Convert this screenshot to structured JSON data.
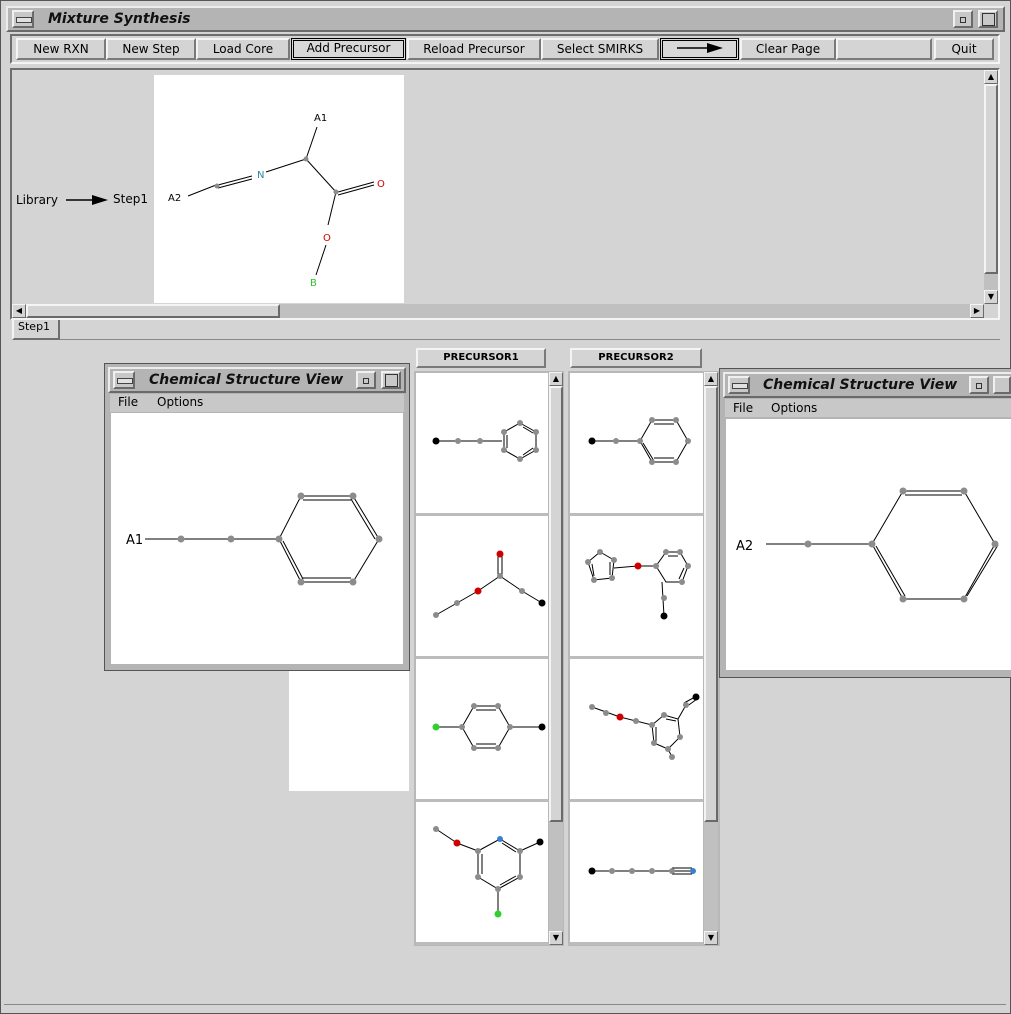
{
  "main_window": {
    "title": "Mixture Synthesis"
  },
  "toolbar": {
    "new_rxn": "New RXN",
    "new_step": "New Step",
    "load_core": "Load Core",
    "add_precursor": "Add Precursor",
    "reload_precursor": "Reload Precursor",
    "select_smirks": "Select SMIRKS",
    "arrow_icon": "right-arrow-icon",
    "clear_page": "Clear Page",
    "quit": "Quit"
  },
  "reaction": {
    "library_label": "Library",
    "step_label": "Step1",
    "core_atoms": {
      "a1": "A1",
      "a2": "A2",
      "n": "N",
      "o_double": "O",
      "o_single": "O",
      "b": "B"
    }
  },
  "tabs": {
    "step1": "Step1"
  },
  "precursor_columns": {
    "col1_header": "PRECURSOR1",
    "col2_header": "PRECURSOR2"
  },
  "structure_view_left": {
    "title": "Chemical Structure View",
    "menu_file": "File",
    "menu_options": "Options",
    "attach_label": "A1"
  },
  "structure_view_right": {
    "title": "Chemical Structure View",
    "menu_file": "File",
    "menu_options": "Options",
    "attach_label": "A2"
  },
  "colors": {
    "atom_carbon": "#8c8c8c",
    "atom_attach": "#000000",
    "atom_oxygen": "#d00000",
    "atom_nitrogen": "#3a7fd0",
    "atom_halogen": "#30d030",
    "label_oxygen": "#d00000",
    "label_nitrogen": "#2a8aa0",
    "label_boron": "#30c030"
  }
}
